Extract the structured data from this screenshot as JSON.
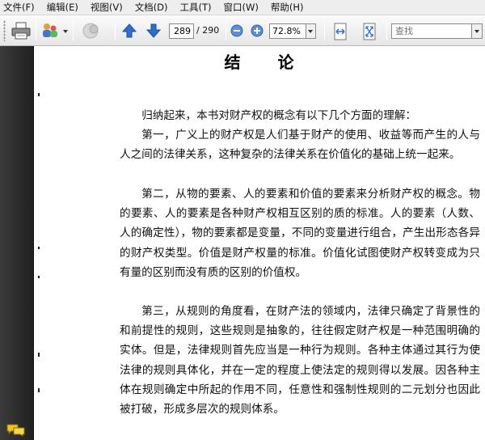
{
  "menu": {
    "items": [
      "文件(F)",
      "编辑(E)",
      "视图(V)",
      "文档(D)",
      "工具(T)",
      "窗口(W)",
      "帮助(H)"
    ]
  },
  "toolbar": {
    "page_current": "289",
    "page_total": "/ 290",
    "zoom": "72.8%",
    "search_placeholder": "查找",
    "icons": [
      "print-icon",
      "share-icon",
      "attach-icon",
      "prev-page-icon",
      "next-page-icon",
      "zoom-out-icon",
      "zoom-in-icon",
      "fit-width-icon",
      "fit-page-icon"
    ],
    "accent": "#2c6fd1"
  },
  "document": {
    "title_left": "结",
    "title_right": "论",
    "paragraphs": [
      "归纳起来，本书对财产权的概念有以下几个方面的理解：",
      "第一，广义上的财产权是人们基于财产的使用、收益等而产生的人与人之间的法律关系，这种复杂的法律关系在价值化的基础上统一起来。",
      "第二，从物的要素、人的要素和价值的要素来分析财产权的概念。物的要素、人的要素是各种财产权相互区别的质的标准。人的要素（人数、人的确定性），物的要素都是变量，不同的变量进行组合，产生出形态各异的财产权类型。价值是财产权量的标准。价值化试图使财产权转变成为只有量的区别而没有质的区别的价值权。",
      "第三，从规则的角度看，在财产法的领域内，法律只确定了背景性的和前提性的规则，这些规则是抽象的，往往假定财产权是一种范围明确的实体。但是，法律规则首先应当是一种行为规则。各种主体通过其行为使法律的规则具体化，并在一定的程度上使法定的规则得以发展。因各种主体在规则确定中所起的作用不同，任意性和强制性规则的二元划分也因此被打破，形成多层次的规则体系。"
    ]
  }
}
